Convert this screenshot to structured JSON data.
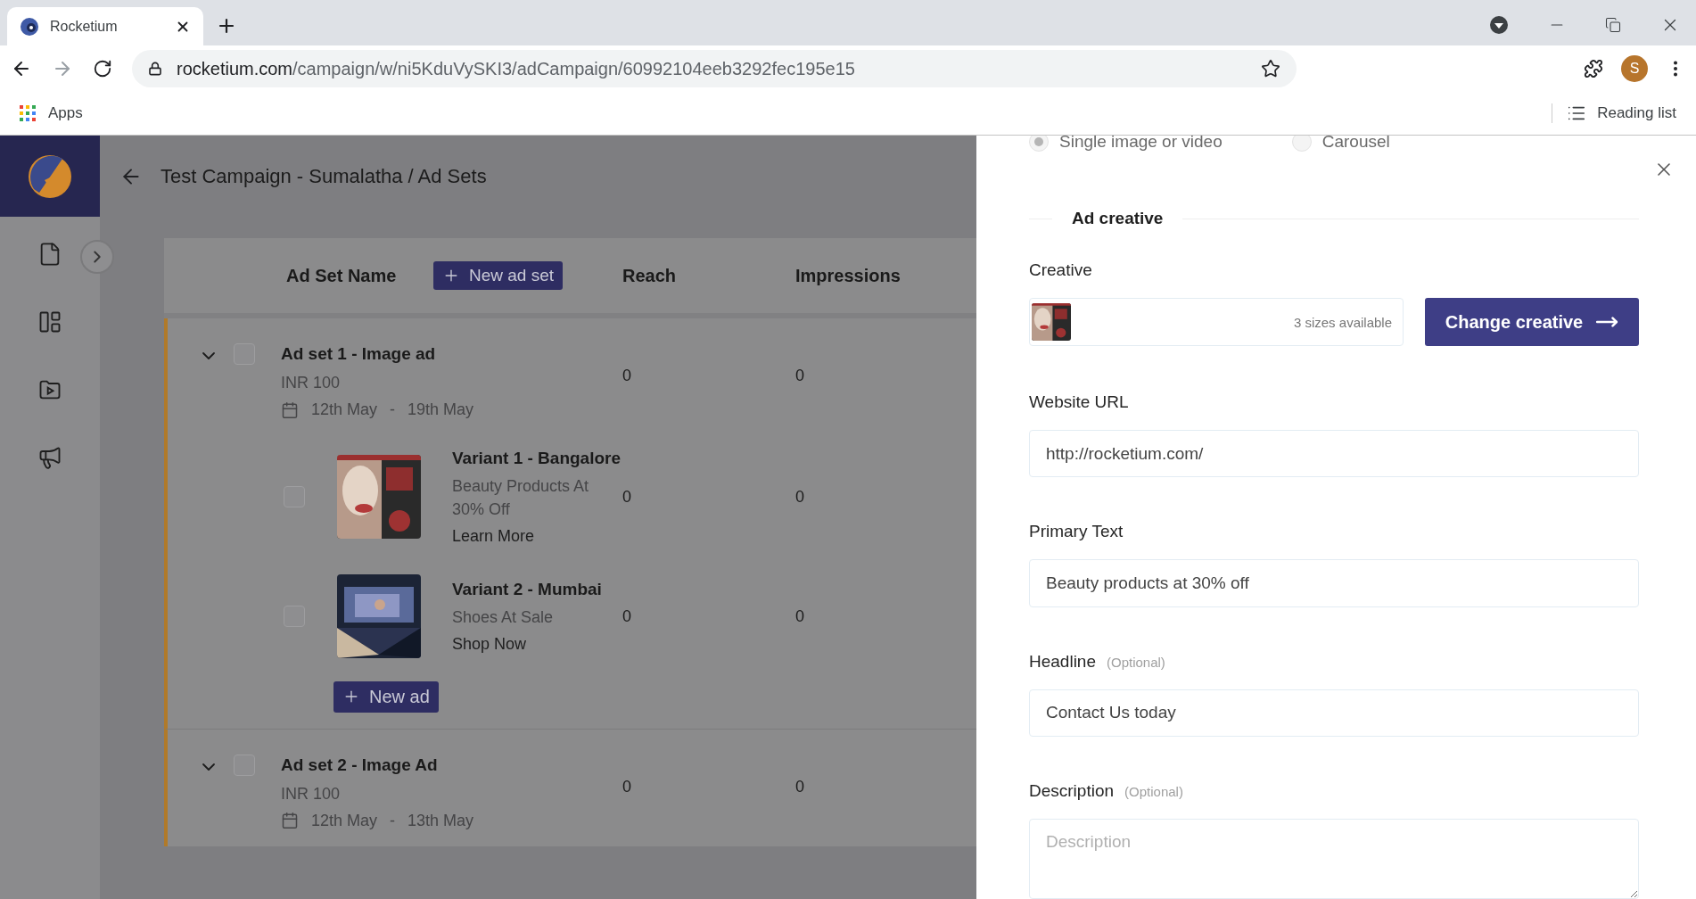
{
  "browser": {
    "tab_title": "Rocketium",
    "url_domain": "rocketium.com",
    "url_path": "/campaign/w/ni5KduVySKI3/adCampaign/60992104eeb3292fec195e15",
    "profile_initial": "S",
    "bookmarks": [
      {
        "label": "Apps"
      }
    ],
    "reading_list": "Reading list"
  },
  "header": {
    "title": "Test Campaign - Sumalatha / Ad Sets"
  },
  "table": {
    "columns": [
      "Ad Set Name",
      "Reach",
      "Impressions"
    ],
    "new_ad_set": "New ad set",
    "ad_sets": [
      {
        "name": "Ad set 1 - Image ad",
        "budget": "INR 100",
        "start": "12th May",
        "separator": "-",
        "end": "19th May",
        "expanded": true,
        "checked": false,
        "reach": "0",
        "impressions": "0",
        "ads": [
          {
            "name": "Variant 1 - Bangalore",
            "text": "Beauty Products At 30% Off",
            "cta": "Learn More",
            "checked": false,
            "reach": "0",
            "impressions": "0"
          },
          {
            "name": "Variant 2 - Mumbai",
            "text": "Shoes At Sale",
            "cta": "Shop Now",
            "checked": false,
            "reach": "0",
            "impressions": "0"
          }
        ],
        "new_ad": "New ad"
      },
      {
        "name": "Ad set 2 - Image Ad",
        "budget": "INR 100",
        "start": "12th May",
        "separator": "-",
        "end": "13th May",
        "expanded": true,
        "checked": false,
        "reach": "0",
        "impressions": "0"
      }
    ]
  },
  "drawer": {
    "format_options": [
      {
        "label": "Single image or video",
        "selected": true
      },
      {
        "label": "Carousel",
        "selected": false
      }
    ],
    "section_title": "Ad creative",
    "creative": {
      "label": "Creative",
      "sizes": "3 sizes available",
      "button": "Change creative"
    },
    "fields": [
      {
        "label": "Website URL",
        "value": "http://rocketium.com/"
      },
      {
        "label": "Primary Text",
        "value": "Beauty products at 30% off"
      },
      {
        "label": "Headline",
        "note": "(Optional)",
        "value": "Contact Us today"
      },
      {
        "label": "Description",
        "note": "(Optional)",
        "placeholder": "Description",
        "multiline": true
      }
    ]
  }
}
